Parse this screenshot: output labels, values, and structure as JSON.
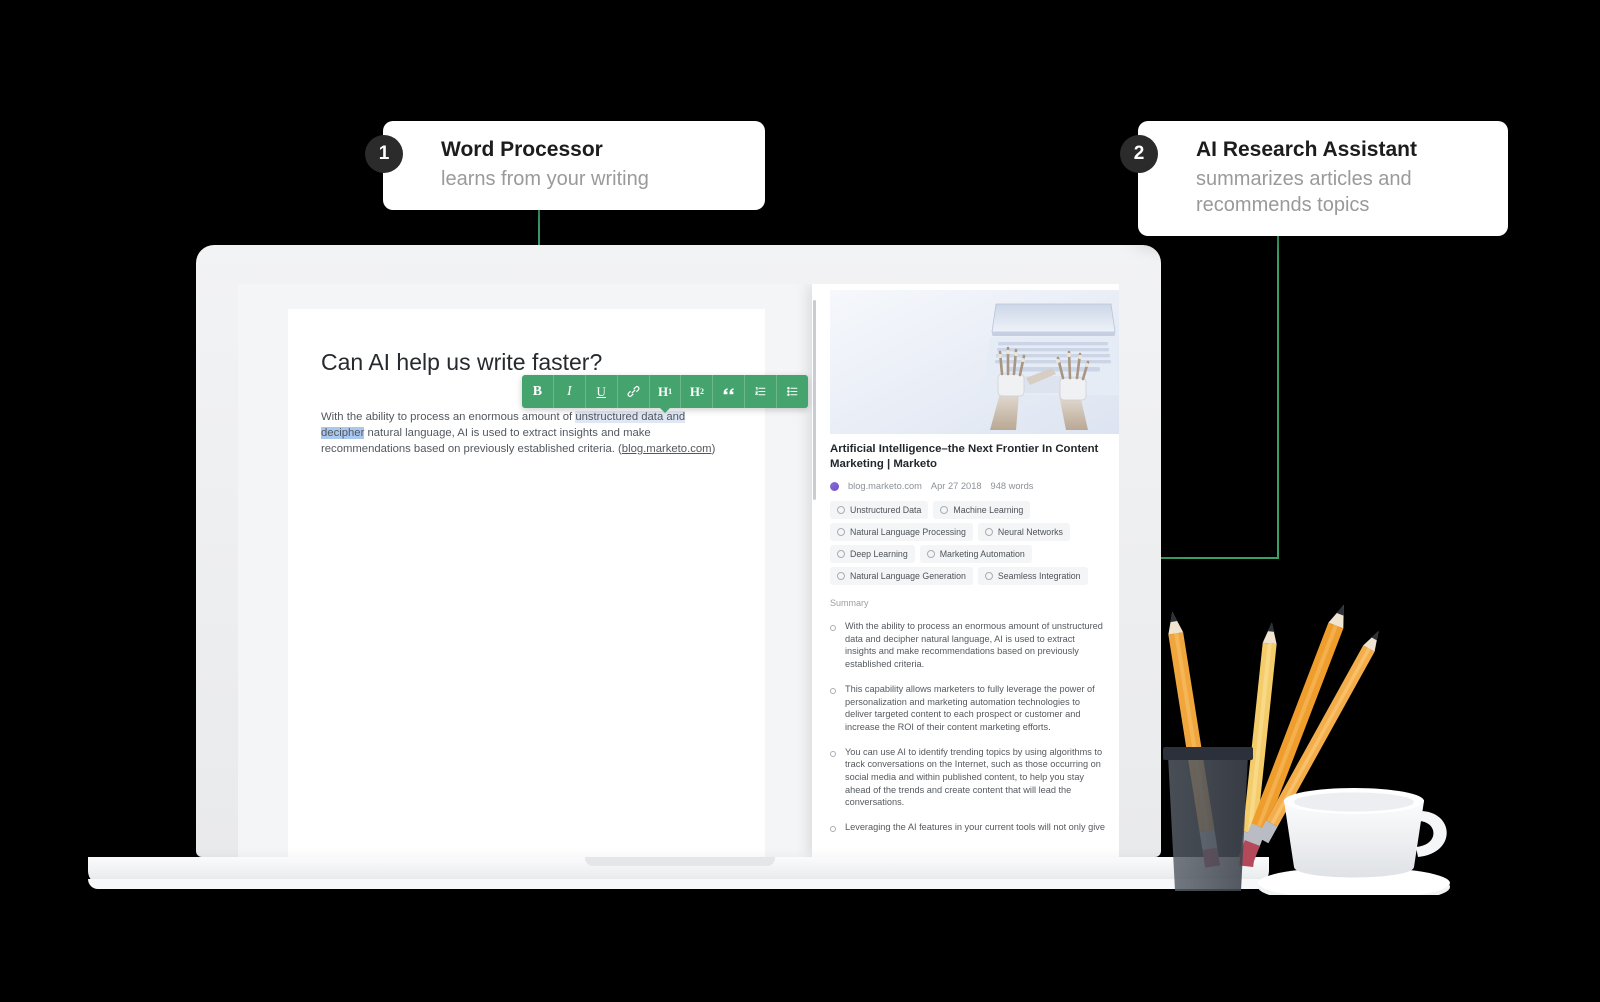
{
  "callouts": [
    {
      "number": "1",
      "title": "Word Processor",
      "subtitle": "learns from your writing"
    },
    {
      "number": "2",
      "title": "AI Research Assistant",
      "subtitle": "summarizes articles and recommends topics"
    }
  ],
  "document": {
    "title": "Can AI help us write faster?",
    "body_part1": "With the ability to process an enormous amount of ",
    "body_highlight_soft": "unstructured data and ",
    "body_highlight_strong": "decipher",
    "body_part2": " natural language, AI is used to extract insights and make recommendations based on previously established criteria. (",
    "body_link": "blog.marketo.com",
    "body_part3": ")"
  },
  "toolbar": {
    "bold": "B",
    "italic": "I",
    "underline": "U",
    "link": "✎",
    "heading1": "H",
    "heading1_sup": "1",
    "heading2": "H",
    "heading2_sup": "2",
    "quote": "❞",
    "ordered_list": "≔",
    "bullet_list": "≔",
    "accent_color": "#45a36e"
  },
  "article": {
    "title": "Artificial Intelligence–the Next Frontier In Content Marketing | Marketo",
    "source": "blog.marketo.com",
    "date": "Apr 27 2018",
    "word_count": "948 words",
    "hero_alt": "robot-hands-typing-on-laptop",
    "tags": [
      "Unstructured Data",
      "Machine Learning",
      "Natural Language Processing",
      "Neural Networks",
      "Deep Learning",
      "Marketing Automation",
      "Natural Language Generation",
      "Seamless Integration"
    ],
    "summary_label": "Summary",
    "summary": [
      "With the ability to process an enormous amount of unstructured data and decipher natural language, AI is used to extract insights and make recommendations based on previously established criteria.",
      "This capability allows marketers to fully leverage the power of personalization and marketing automation technologies to deliver targeted content to each prospect or customer and increase the ROI of their content marketing efforts.",
      "You can use AI to identify trending topics by using algorithms to track conversations on the Internet, such as those occurring on social media and within published content, to help you stay ahead of the trends and create content that will lead the conversations.",
      "Leveraging the AI features in your current tools will not only give"
    ]
  },
  "colors": {
    "accent_green": "#3aa06a",
    "toolbar_green": "#45a36e",
    "badge_dark": "#2b2b2b",
    "selection_soft": "#dfe7f5",
    "selection_strong": "#a9c8f0"
  }
}
